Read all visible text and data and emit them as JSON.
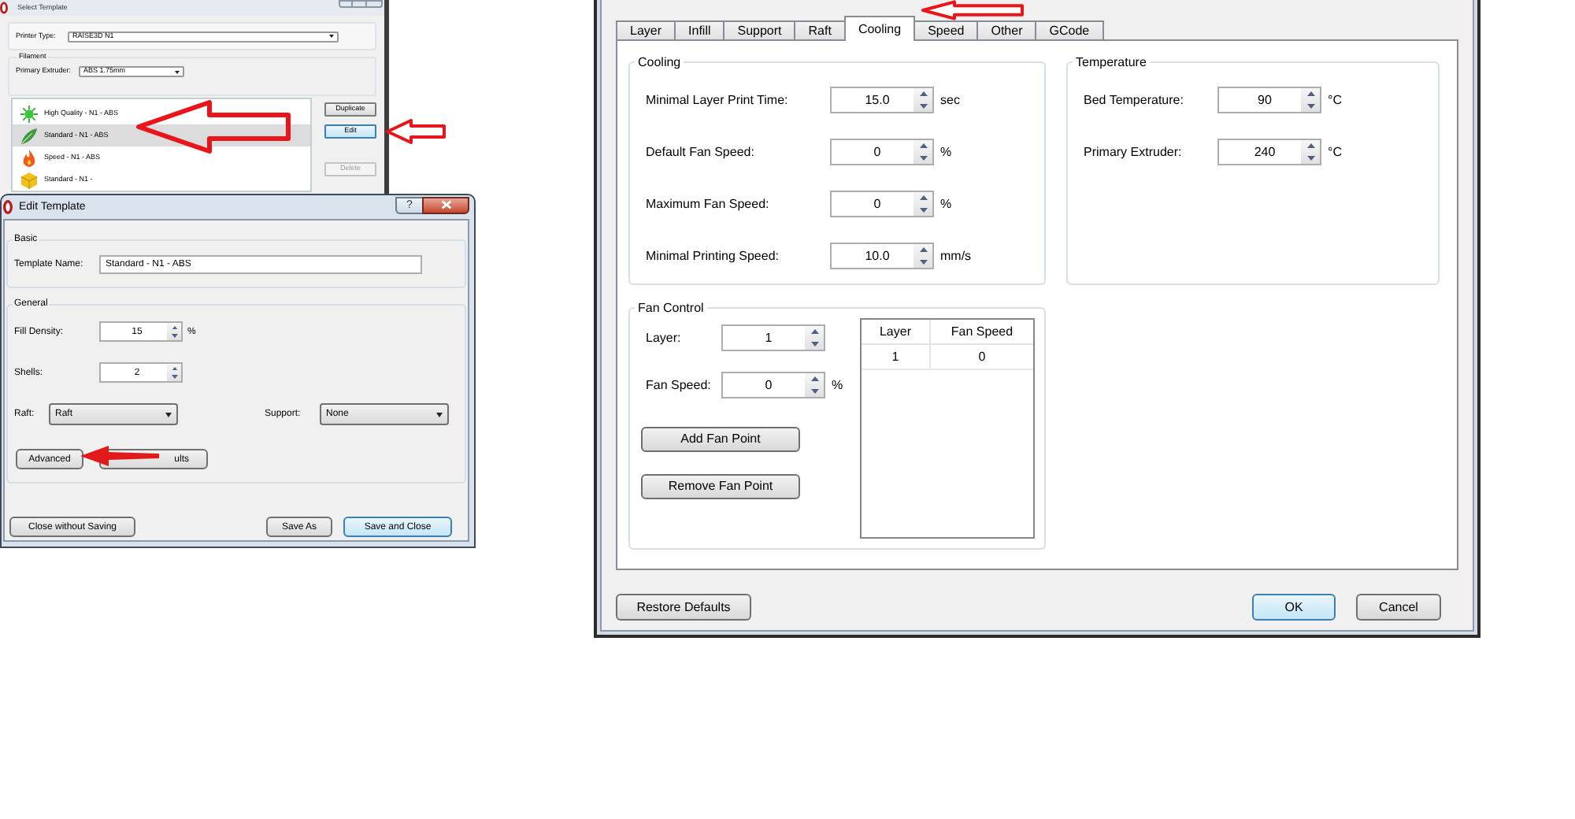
{
  "select_template_window": {
    "title": "Select Template",
    "printer_type": {
      "label": "Printer Type:",
      "value": "RAISE3D N1"
    },
    "filament": {
      "title": "Filament",
      "primary_extruder": {
        "label": "Primary Extruder:",
        "value": "ABS 1.75mm"
      }
    },
    "templates": [
      {
        "kind": "burst",
        "label": "High Quality - N1 - ABS",
        "selected": false
      },
      {
        "kind": "leaf",
        "label": "Standard - N1 - ABS",
        "selected": true
      },
      {
        "kind": "flame",
        "label": "Speed - N1 - ABS",
        "selected": false
      },
      {
        "kind": "cube",
        "label": "Standard - N1 -",
        "selected": false
      }
    ],
    "buttons": [
      {
        "label": "Duplicate",
        "focused": false,
        "disabled": false
      },
      {
        "label": "Edit",
        "focused": true,
        "disabled": false
      },
      {
        "label": "Delete",
        "focused": false,
        "disabled": true
      }
    ]
  },
  "edit_template_window": {
    "title": "Edit Template",
    "help": "?",
    "basic": {
      "title": "Basic",
      "template_name": {
        "label": "Template Name:",
        "value": "Standard - N1 - ABS"
      }
    },
    "general": {
      "title": "General",
      "fill_density": {
        "label": "Fill Density:",
        "value": "15",
        "unit": "%"
      },
      "shells": {
        "label": "Shells:",
        "value": "2"
      },
      "raft": {
        "label": "Raft:",
        "value": "Raft"
      },
      "support": {
        "label": "Support:",
        "value": "None"
      },
      "buttons": [
        {
          "label": "Advanced"
        },
        {
          "label": "ults"
        }
      ]
    },
    "footer_buttons": [
      {
        "label": "Close without Saving",
        "focused": false
      },
      {
        "label": "Save As",
        "focused": false
      },
      {
        "label": "Save and Close",
        "focused": true
      }
    ]
  },
  "settings_window": {
    "tabs": [
      {
        "label": "Layer",
        "selected": false
      },
      {
        "label": "Infill",
        "selected": false
      },
      {
        "label": "Support",
        "selected": false
      },
      {
        "label": "Raft",
        "selected": false
      },
      {
        "label": "Cooling",
        "selected": true
      },
      {
        "label": "Speed",
        "selected": false
      },
      {
        "label": "Other",
        "selected": false
      },
      {
        "label": "GCode",
        "selected": false
      }
    ],
    "cooling": {
      "title": "Cooling",
      "fields": [
        {
          "label": "Minimal Layer Print Time:",
          "value": "15.0",
          "unit": "sec"
        },
        {
          "label": "Default Fan Speed:",
          "value": "0",
          "unit": "%"
        },
        {
          "label": "Maximum Fan Speed:",
          "value": "0",
          "unit": "%"
        },
        {
          "label": "Minimal Printing Speed:",
          "value": "10.0",
          "unit": "mm/s"
        }
      ]
    },
    "temperature": {
      "title": "Temperature",
      "fields": [
        {
          "label": "Bed Temperature:",
          "value": "90",
          "unit": "°C"
        },
        {
          "label": "Primary Extruder:",
          "value": "240",
          "unit": "°C"
        }
      ]
    },
    "fan_control": {
      "title": "Fan Control",
      "layer": {
        "label": "Layer:",
        "value": "1"
      },
      "fan_speed": {
        "label": "Fan Speed:",
        "value": "0",
        "unit": "%"
      },
      "buttons": [
        "Add Fan Point",
        "Remove Fan Point"
      ],
      "table": {
        "columns": [
          "Layer",
          "Fan Speed"
        ],
        "rows": [
          [
            "1",
            "0"
          ]
        ]
      }
    },
    "buttons": [
      {
        "label": "Restore Defaults",
        "focused": false
      },
      {
        "label": "OK",
        "focused": true
      },
      {
        "label": "Cancel",
        "focused": false
      }
    ]
  }
}
